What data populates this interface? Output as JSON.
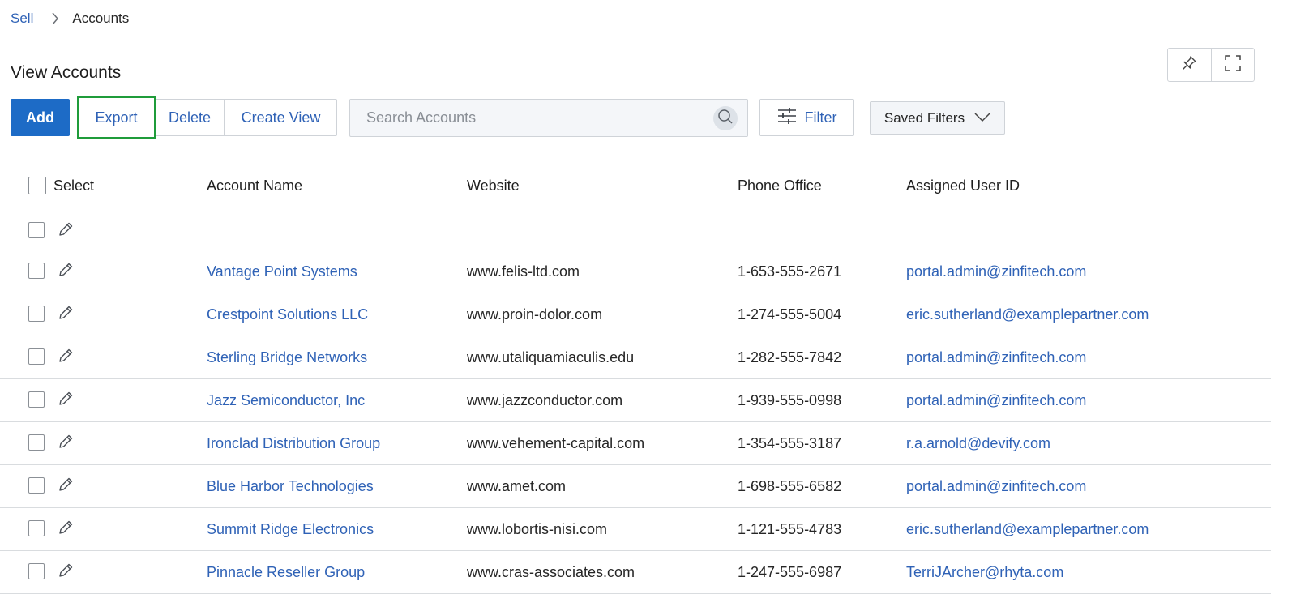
{
  "breadcrumb": {
    "parent": "Sell",
    "current": "Accounts"
  },
  "page_title": "View Accounts",
  "toolbar": {
    "add_label": "Add",
    "export_label": "Export",
    "delete_label": "Delete",
    "create_view_label": "Create View",
    "filter_label": "Filter",
    "saved_filters_label": "Saved Filters"
  },
  "search": {
    "placeholder": "Search Accounts",
    "value": ""
  },
  "table": {
    "headers": {
      "select": "Select",
      "account_name": "Account Name",
      "website": "Website",
      "phone_office": "Phone Office",
      "assigned_user_id": "Assigned User ID"
    },
    "rows": [
      {
        "account_name": "",
        "website": "",
        "phone_office": "",
        "assigned_user_id": ""
      },
      {
        "account_name": "Vantage Point Systems",
        "website": "www.felis-ltd.com",
        "phone_office": "1-653-555-2671",
        "assigned_user_id": "portal.admin@zinfitech.com"
      },
      {
        "account_name": "Crestpoint Solutions LLC",
        "website": "www.proin-dolor.com",
        "phone_office": "1-274-555-5004",
        "assigned_user_id": "eric.sutherland@examplepartner.com"
      },
      {
        "account_name": "Sterling Bridge Networks",
        "website": "www.utaliquamiaculis.edu",
        "phone_office": "1-282-555-7842",
        "assigned_user_id": "portal.admin@zinfitech.com"
      },
      {
        "account_name": "Jazz Semiconductor, Inc",
        "website": "www.jazzconductor.com",
        "phone_office": "1-939-555-0998",
        "assigned_user_id": "portal.admin@zinfitech.com"
      },
      {
        "account_name": "Ironclad Distribution Group",
        "website": "www.vehement-capital.com",
        "phone_office": "1-354-555-3187",
        "assigned_user_id": "r.a.arnold@devify.com"
      },
      {
        "account_name": "Blue Harbor Technologies",
        "website": "www.amet.com",
        "phone_office": "1-698-555-6582",
        "assigned_user_id": "portal.admin@zinfitech.com"
      },
      {
        "account_name": "Summit Ridge Electronics",
        "website": "www.lobortis-nisi.com",
        "phone_office": "1-121-555-4783",
        "assigned_user_id": "eric.sutherland@examplepartner.com"
      },
      {
        "account_name": "Pinnacle Reseller Group",
        "website": "www.cras-associates.com",
        "phone_office": "1-247-555-6987",
        "assigned_user_id": "TerriJArcher@rhyta.com"
      }
    ]
  },
  "icons": {
    "breadcrumb_separator": "chevron-right-icon",
    "pin": "pin-icon",
    "fullscreen": "fullscreen-icon",
    "search": "search-icon",
    "filter": "sliders-icon",
    "saved_filters": "chevron-down-icon",
    "row_edit": "pencil-icon"
  },
  "colors": {
    "primary": "#1d6bc6",
    "link": "#2f62b6",
    "focus_outline": "#1f9c3a",
    "border": "#cfd3d8"
  }
}
